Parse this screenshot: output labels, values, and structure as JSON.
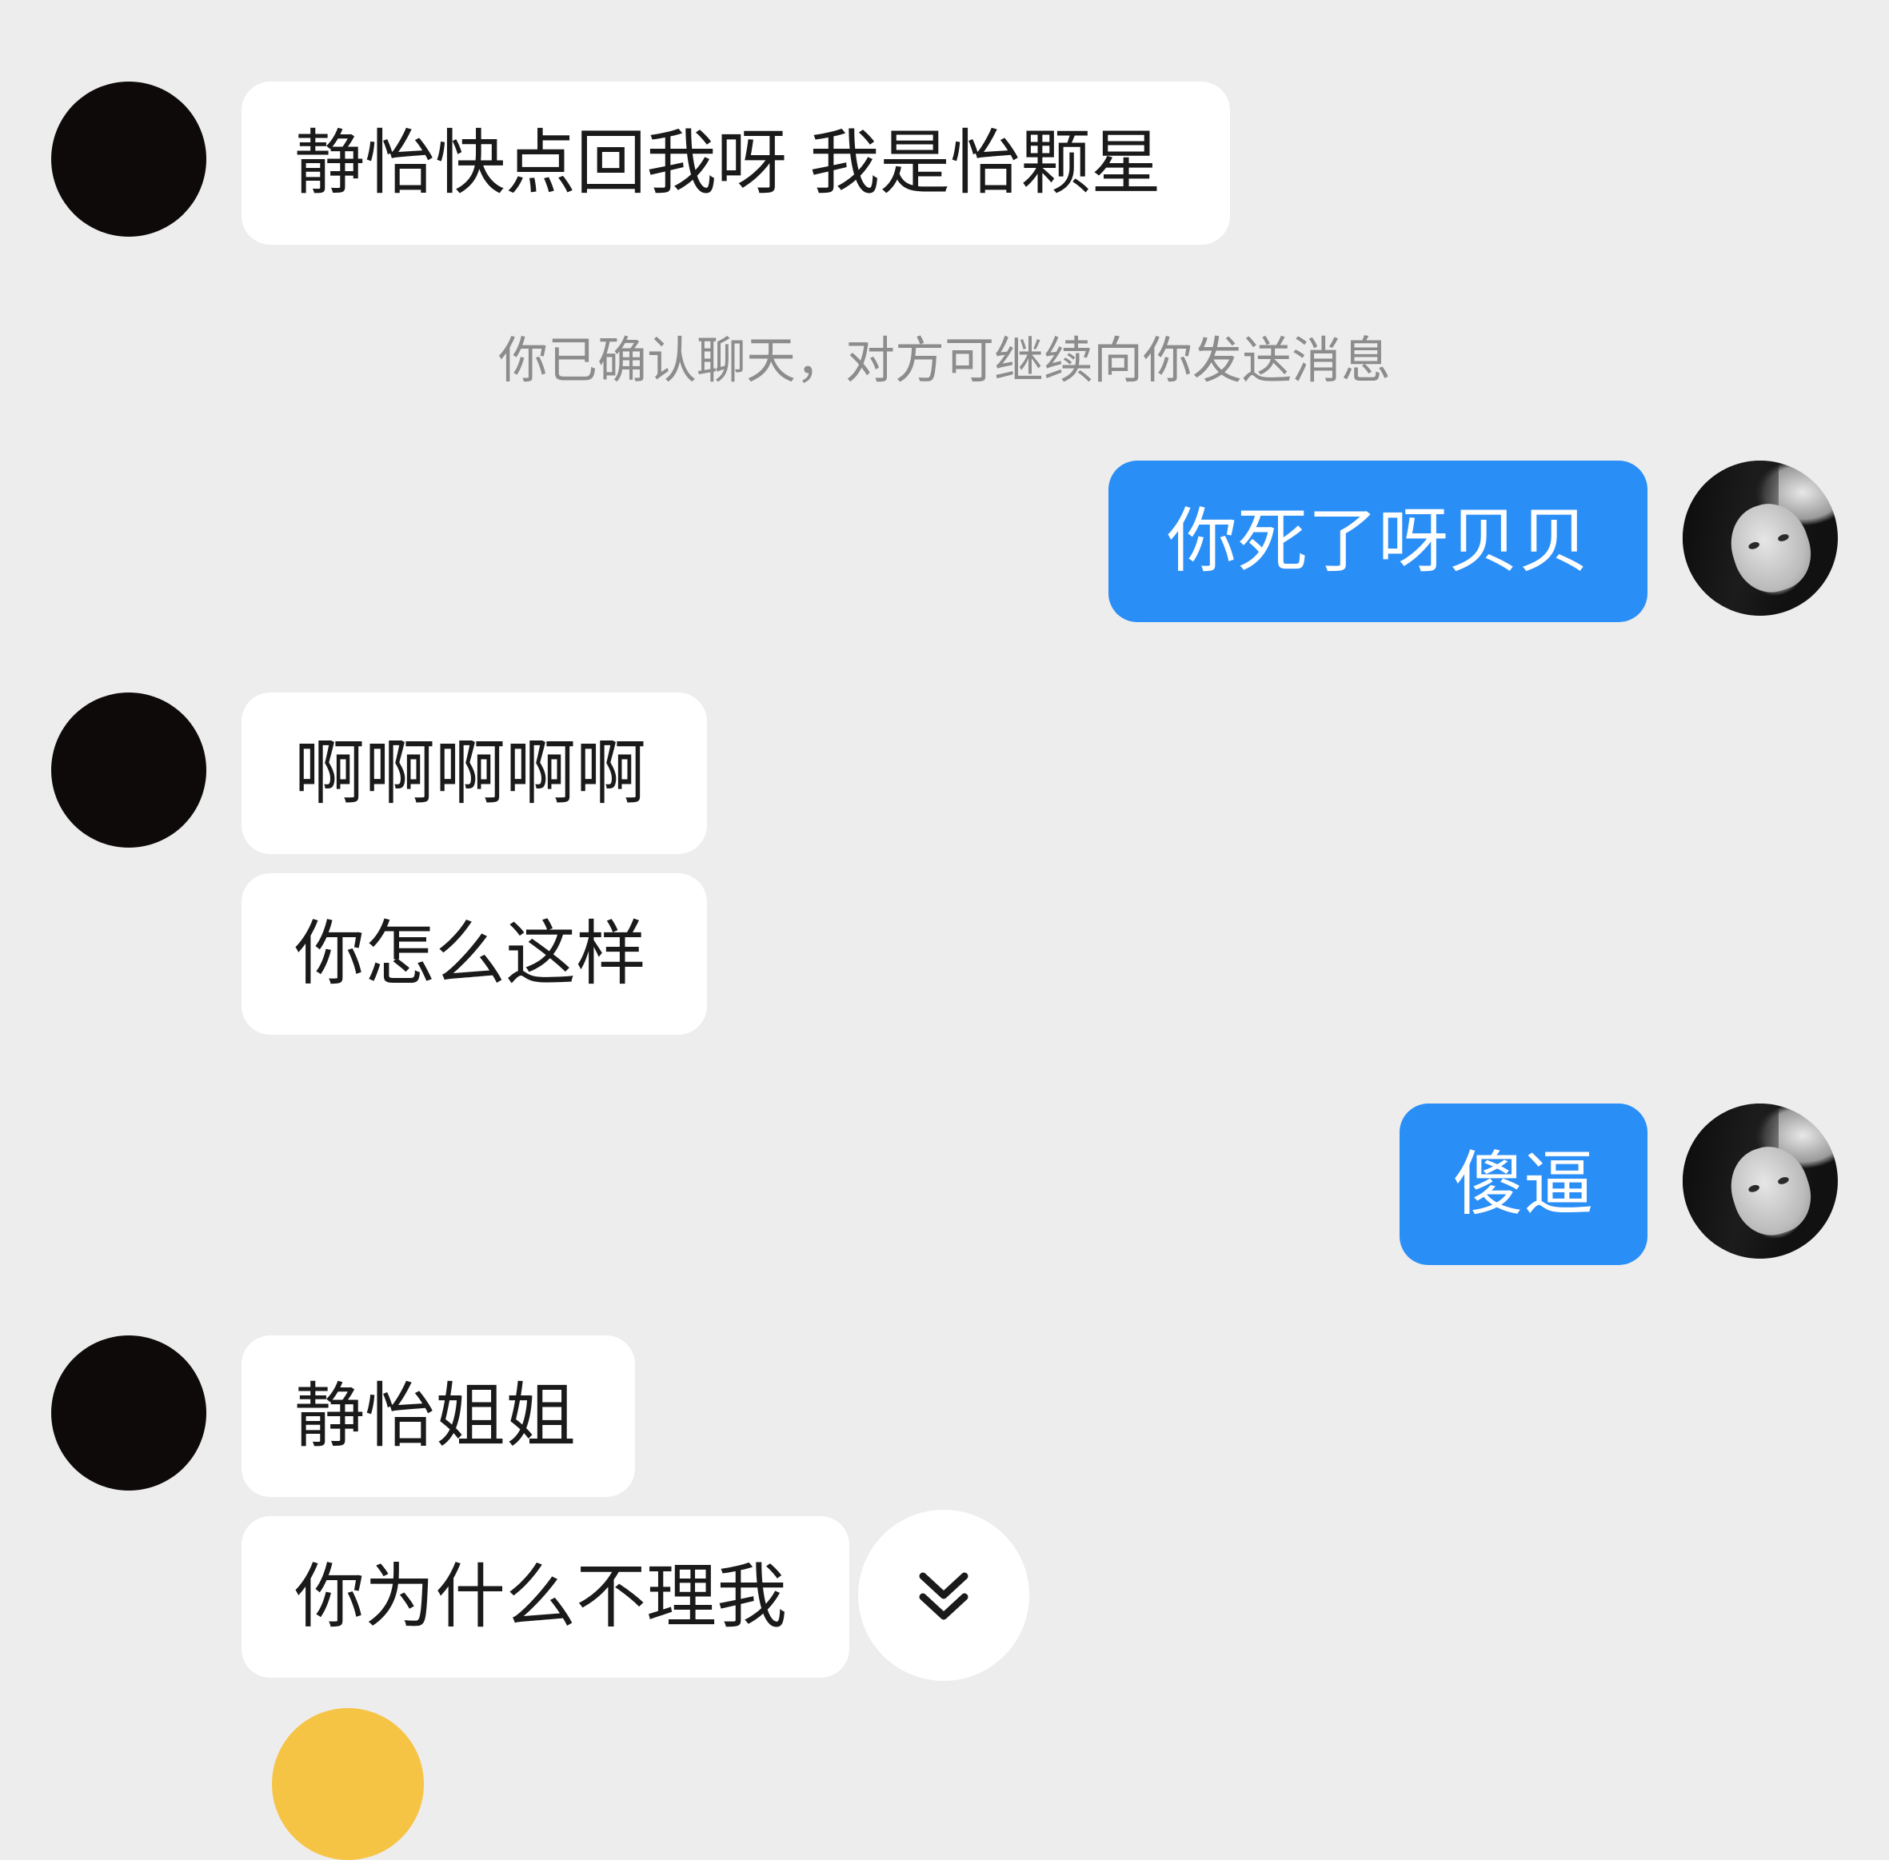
{
  "conversation": {
    "notice": "你已确认聊天，对方可继续向你发送消息",
    "messages": [
      {
        "sender": "other",
        "text": "静怡快点回我呀 我是怡颗星"
      },
      {
        "sender": "me",
        "text": "你死了呀贝贝"
      },
      {
        "sender": "other",
        "text": "啊啊啊啊啊"
      },
      {
        "sender": "other",
        "text": "你怎么这样"
      },
      {
        "sender": "me",
        "text": "傻逼"
      },
      {
        "sender": "other",
        "text": "静怡姐姐"
      },
      {
        "sender": "other",
        "text": "你为什么不理我"
      }
    ]
  },
  "controls": {
    "scroll_to_bottom_icon": "double-chevron-down-icon"
  },
  "colors": {
    "background": "#ededed",
    "incoming_bubble": "#ffffff",
    "outgoing_bubble": "#2a8ef7",
    "notice_text": "#8c8c8c",
    "other_avatar": "#0d0a09",
    "peek_avatar": "#f6c445"
  }
}
